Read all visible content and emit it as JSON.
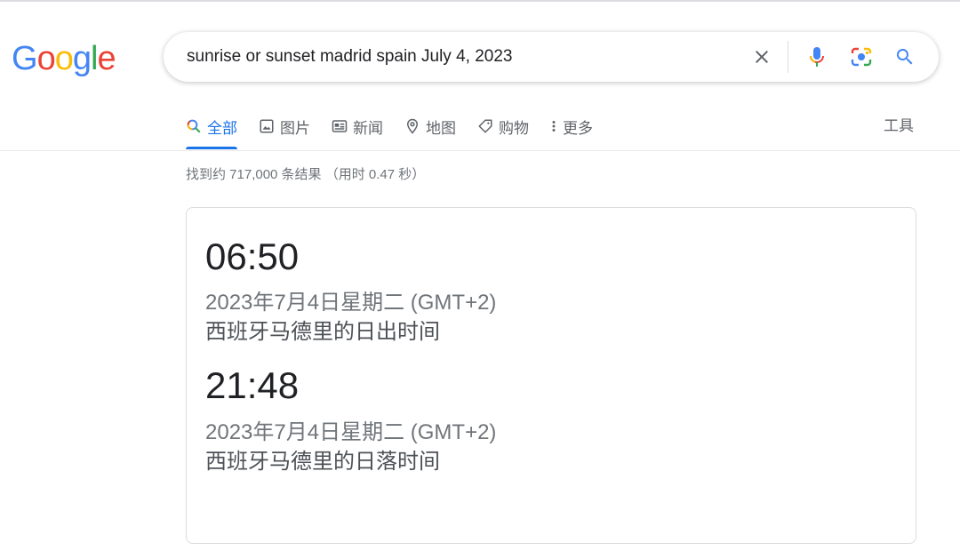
{
  "logo": {
    "letters": [
      "G",
      "o",
      "o",
      "g",
      "l",
      "e"
    ],
    "colors": [
      "#4285F4",
      "#EA4335",
      "#FBBC05",
      "#4285F4",
      "#34A853",
      "#EA4335"
    ]
  },
  "search": {
    "query": "sunrise or sunset madrid spain July 4, 2023",
    "icons": [
      "close-icon",
      "mic-icon",
      "camera-lens-icon",
      "search-icon"
    ]
  },
  "tabs": [
    {
      "label": "全部",
      "icon": "search-icon",
      "active": true
    },
    {
      "label": "图片",
      "icon": "image-icon",
      "active": false
    },
    {
      "label": "新闻",
      "icon": "news-icon",
      "active": false
    },
    {
      "label": "地图",
      "icon": "map-pin-icon",
      "active": false
    },
    {
      "label": "购物",
      "icon": "tag-icon",
      "active": false
    },
    {
      "label": "更多",
      "icon": "more-vert-icon",
      "active": false
    }
  ],
  "tools_label": "工具",
  "result_stats": "找到约 717,000 条结果 （用时 0.47 秒）",
  "answer": {
    "sunrise": {
      "time": "06:50",
      "date": "2023年7月4日星期二 (GMT+2)",
      "caption": "西班牙马德里的日出时间"
    },
    "sunset": {
      "time": "21:48",
      "date": "2023年7月4日星期二 (GMT+2)",
      "caption": "西班牙马德里的日落时间"
    }
  },
  "colors": {
    "accent": "#1a73e8",
    "text_primary": "#202124",
    "text_secondary": "#70757a",
    "border": "#dadce0"
  }
}
